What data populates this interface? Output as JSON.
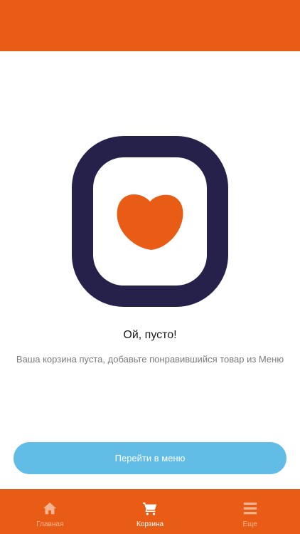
{
  "colors": {
    "brand_orange": "#e95c15",
    "logo_navy": "#25214b",
    "button_blue": "#61bce6",
    "nav_inactive": "#f6b592",
    "nav_active": "#ffffff"
  },
  "empty_state": {
    "illustration_icon": "heart-in-rounded-square-icon",
    "title": "Ой, пусто!",
    "message": "Ваша корзина пуста, добавьте понравившийся товар из Меню"
  },
  "actions": {
    "go_to_menu_label": "Перейти в меню"
  },
  "bottom_nav": {
    "items": [
      {
        "label": "Главная",
        "icon": "home-icon",
        "active": false
      },
      {
        "label": "Корзина",
        "icon": "cart-icon",
        "active": true
      },
      {
        "label": "Еще",
        "icon": "menu-icon",
        "active": false
      }
    ]
  }
}
